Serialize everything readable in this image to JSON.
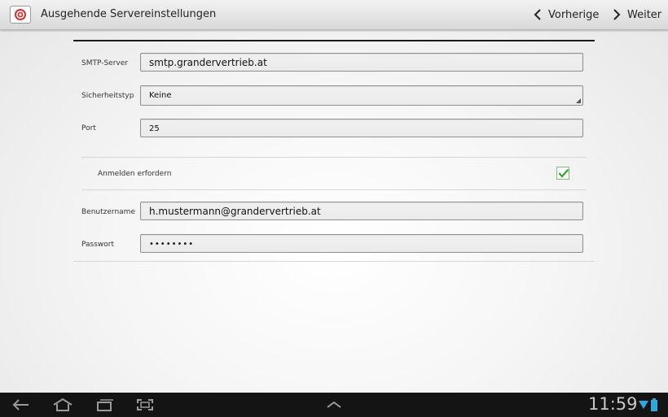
{
  "actionbar": {
    "title": "Ausgehende Servereinstellungen",
    "prev_label": "Vorherige",
    "next_label": "Weiter",
    "app_icon": "email-app-icon"
  },
  "form": {
    "smtp_label": "SMTP-Server",
    "smtp_value": "smtp.grandervertrieb.at",
    "security_label": "Sicherheitstyp",
    "security_value": "Keine",
    "port_label": "Port",
    "port_value": "25",
    "login_required_label": "Anmelden erfordern",
    "login_required_checked": true,
    "username_label": "Benutzername",
    "username_value": "h.mustermann@grandervertrieb.at",
    "password_label": "Passwort",
    "password_value": "••••••••"
  },
  "systembar": {
    "time": "11:59",
    "icons": [
      "back-icon",
      "home-icon",
      "recent-apps-icon",
      "screenshot-icon",
      "up-arrow-icon",
      "wifi-icon",
      "battery-icon"
    ]
  },
  "colors": {
    "checkbox_green": "#2bab2b",
    "status_blue": "#2fa8e0"
  }
}
